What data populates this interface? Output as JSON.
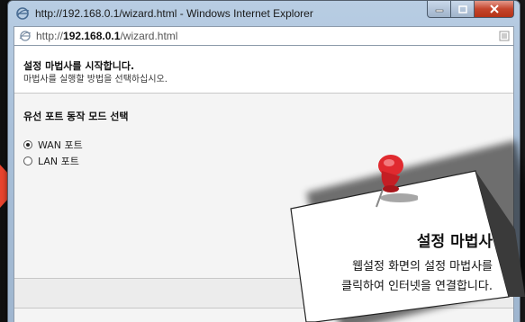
{
  "window": {
    "title": "http://192.168.0.1/wizard.html - Windows Internet Explorer"
  },
  "address": {
    "prefix": "http://",
    "host": "192.168.0.1",
    "path": "/wizard.html"
  },
  "header": {
    "title": "설정 마법사를 시작합니다.",
    "subtitle": "마법사를 실행할 방법을 선택하십시오."
  },
  "section": {
    "title": "유선 포트 동작 모드 선택",
    "options": [
      {
        "label": "WAN 포트",
        "checked": true
      },
      {
        "label": "LAN 포트",
        "checked": false
      }
    ]
  },
  "note": {
    "title": "설정 마법사",
    "line1": "웹설정 화면의 설정 마법사를",
    "line2": "클릭하여 인터넷을 연결합니다."
  },
  "colors": {
    "accent_arrow": "#e8442e",
    "pin": "#d8202a"
  }
}
